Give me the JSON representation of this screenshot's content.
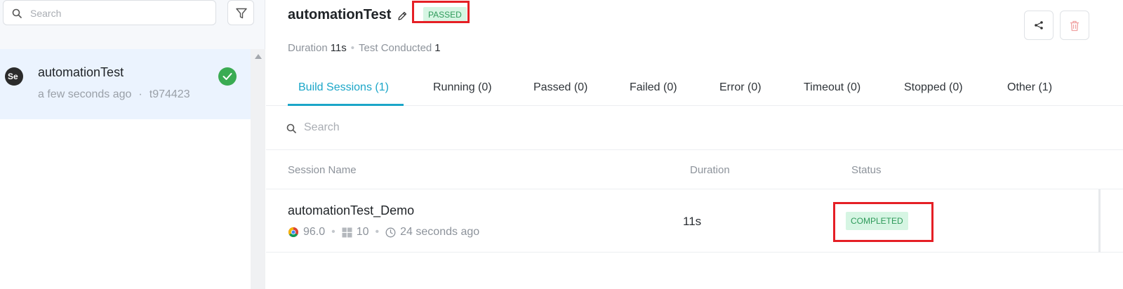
{
  "sidebar": {
    "search_placeholder": "Search",
    "builds": [
      {
        "name": "automationTest",
        "time": "a few seconds ago",
        "separator": "·",
        "build_id": "t974423",
        "logo_text": "Se",
        "status": "passed"
      }
    ]
  },
  "header": {
    "title": "automationTest",
    "status": "PASSED",
    "duration_label": "Duration",
    "duration_value": "11s",
    "separator": "•",
    "tests_label": "Test Conducted",
    "tests_value": "1"
  },
  "tabs": [
    {
      "label": "Build Sessions (1)",
      "active": true
    },
    {
      "label": "Running (0)",
      "active": false
    },
    {
      "label": "Passed (0)",
      "active": false
    },
    {
      "label": "Failed (0)",
      "active": false
    },
    {
      "label": "Error (0)",
      "active": false
    },
    {
      "label": "Timeout (0)",
      "active": false
    },
    {
      "label": "Stopped (0)",
      "active": false
    },
    {
      "label": "Other (1)",
      "active": false
    }
  ],
  "session_search": {
    "placeholder": "Search"
  },
  "table": {
    "columns": [
      "Session Name",
      "Duration",
      "Status"
    ],
    "rows": [
      {
        "name": "automationTest_Demo",
        "browser_version": "96.0",
        "os_version": "10",
        "time": "24 seconds ago",
        "duration": "11s",
        "status": "COMPLETED"
      }
    ]
  },
  "colors": {
    "accent": "#1ba6c8",
    "success_bg": "#d6f5e3",
    "success_text": "#2e9a5a",
    "highlight": "#e51f25",
    "passed_icon": "#3aab52"
  },
  "icons": {
    "search": "search-icon",
    "filter": "filter-icon",
    "edit": "pencil-icon",
    "share": "share-icon",
    "delete": "trash-icon",
    "browser": "chrome-icon",
    "os": "windows-icon",
    "time": "clock-icon",
    "passed": "check-circle-icon"
  }
}
